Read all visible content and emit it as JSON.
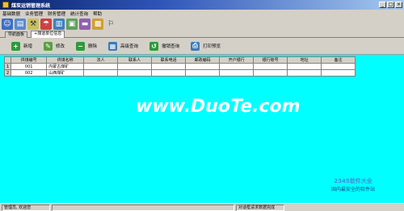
{
  "window": {
    "title": "煤炭运销管理系统",
    "min": "_",
    "max": "□",
    "close": "×"
  },
  "menu": [
    "基础数据",
    "业务管理",
    "财务管理",
    "统计查询",
    "帮助"
  ],
  "tabs": [
    {
      "label": "导航面板"
    },
    {
      "label": "+煤道单位信息"
    }
  ],
  "actions": [
    {
      "label": "新增",
      "color": "#2e9b3a",
      "glyph": "+"
    },
    {
      "label": "修改",
      "color": "#5aa040",
      "glyph": "✎"
    },
    {
      "label": "删除",
      "color": "#2e9b3a",
      "glyph": "−"
    },
    {
      "label": "高级查询",
      "color": "#3c7ab8",
      "glyph": "▦"
    },
    {
      "label": "撤销查询",
      "color": "#2e9b3a",
      "glyph": "↺"
    },
    {
      "label": "打印预览",
      "color": "#3c7ab8",
      "glyph": "⎙"
    }
  ],
  "table": {
    "headers": [
      "供煤编号",
      "供煤名称",
      "法人",
      "联系人",
      "联系电话",
      "邮政编码",
      "开户银行",
      "银行账号",
      "地址",
      "备注"
    ],
    "rows": [
      {
        "no": "1",
        "cells": [
          "001",
          "内蒙古煤矿",
          "",
          "",
          "",
          "",
          "",
          "",
          "",
          ""
        ]
      },
      {
        "no": "2",
        "cells": [
          "002",
          "山西煤矿",
          "",
          "",
          "",
          "",
          "",
          "",
          "",
          ""
        ]
      }
    ]
  },
  "watermark": "www.DuoTe.com",
  "brand": {
    "line1": "2345软件大全",
    "line2": "国内最安全的软件站"
  },
  "status": {
    "user": "管理员, 欢迎您",
    "message": "对话框请求数据完成"
  }
}
